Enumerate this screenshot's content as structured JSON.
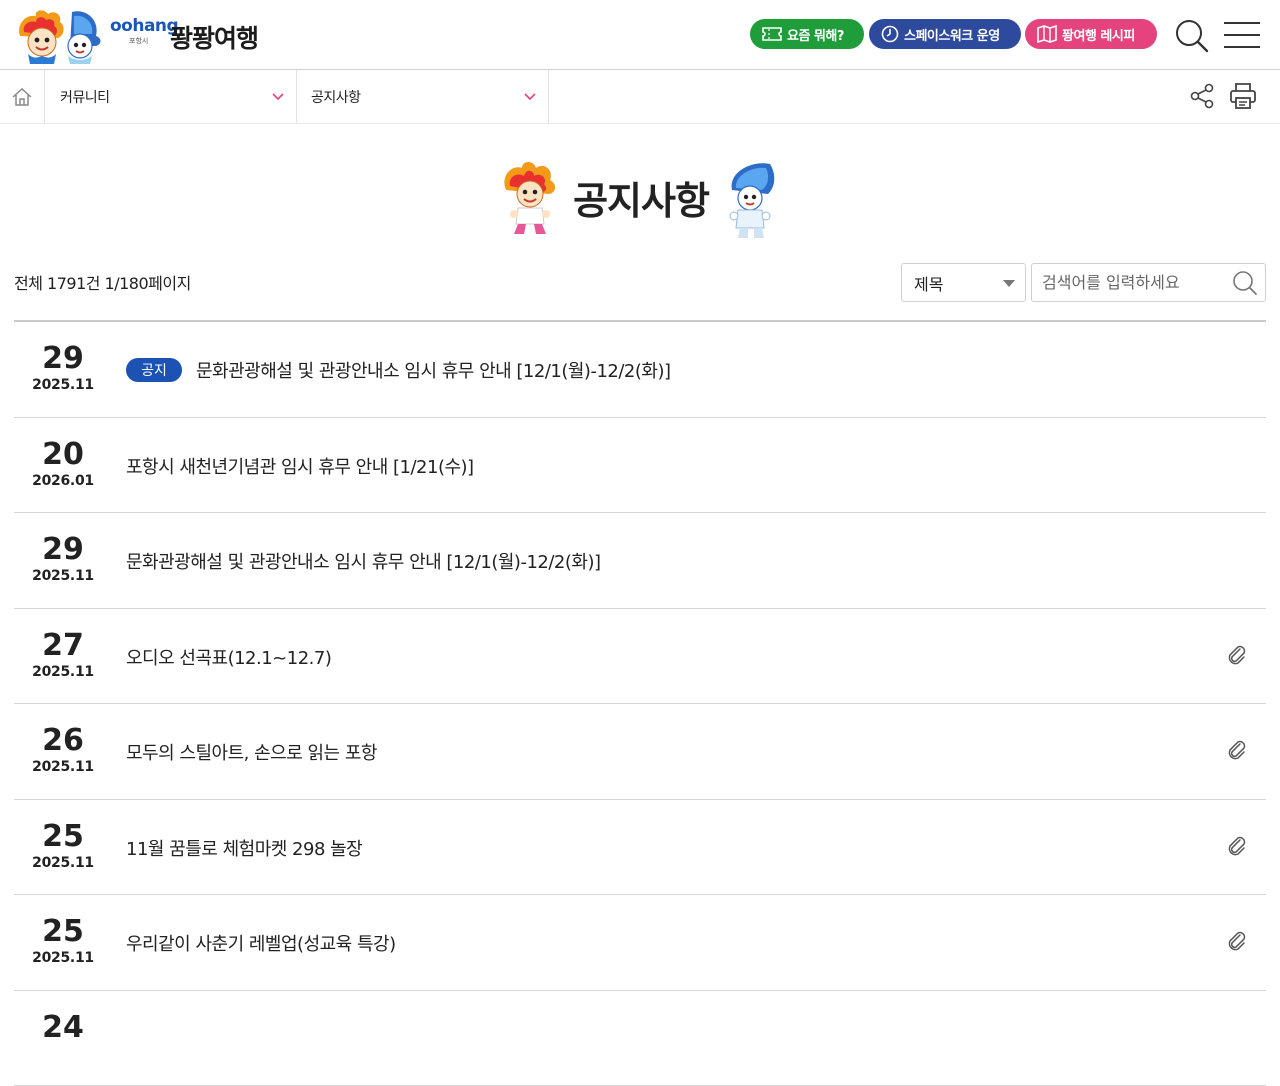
{
  "header": {
    "logo_en": "oohang",
    "logo_en_sub": "포항시",
    "logo_ko": "퐝퐝여행",
    "buttons": [
      {
        "label": "요즘 뭐해?",
        "color": "#1f9d3a"
      },
      {
        "label": "스페이스워크 운영",
        "color": "#2d4a9c"
      },
      {
        "label": "퐝여행 레시피",
        "color": "#e4437e"
      }
    ]
  },
  "breadcrumb": {
    "level1": "커뮤니티",
    "level2": "공지사항"
  },
  "page": {
    "title": "공지사항",
    "count_text": "전체 1791건 1/180페이지"
  },
  "search": {
    "field_selected": "제목",
    "placeholder": "검색어를 입력하세요"
  },
  "colors": {
    "accent_blue": "#1d52b5"
  },
  "posts": [
    {
      "day": "29",
      "ym": "2025.11",
      "badge": "공지",
      "subject": "문화관광해설 및 관광안내소 임시 휴무 안내 [12/1(월)-12/2(화)]",
      "attachment": false
    },
    {
      "day": "20",
      "ym": "2026.01",
      "subject": "포항시 새천년기념관 임시 휴무 안내 [1/21(수)]",
      "attachment": false
    },
    {
      "day": "29",
      "ym": "2025.11",
      "subject": "문화관광해설 및 관광안내소 임시 휴무 안내 [12/1(월)-12/2(화)]",
      "attachment": false
    },
    {
      "day": "27",
      "ym": "2025.11",
      "subject": "오디오 선곡표(12.1~12.7)",
      "attachment": true
    },
    {
      "day": "26",
      "ym": "2025.11",
      "subject": "모두의 스틸아트, 손으로 읽는 포항",
      "attachment": true
    },
    {
      "day": "25",
      "ym": "2025.11",
      "subject": "11월 꿈틀로 체험마켓 298 놀장",
      "attachment": true
    },
    {
      "day": "25",
      "ym": "2025.11",
      "subject": "우리같이 사춘기 레벨업(성교육 특강)",
      "attachment": true
    },
    {
      "day": "24",
      "ym": "",
      "subject": "",
      "attachment": false
    }
  ]
}
